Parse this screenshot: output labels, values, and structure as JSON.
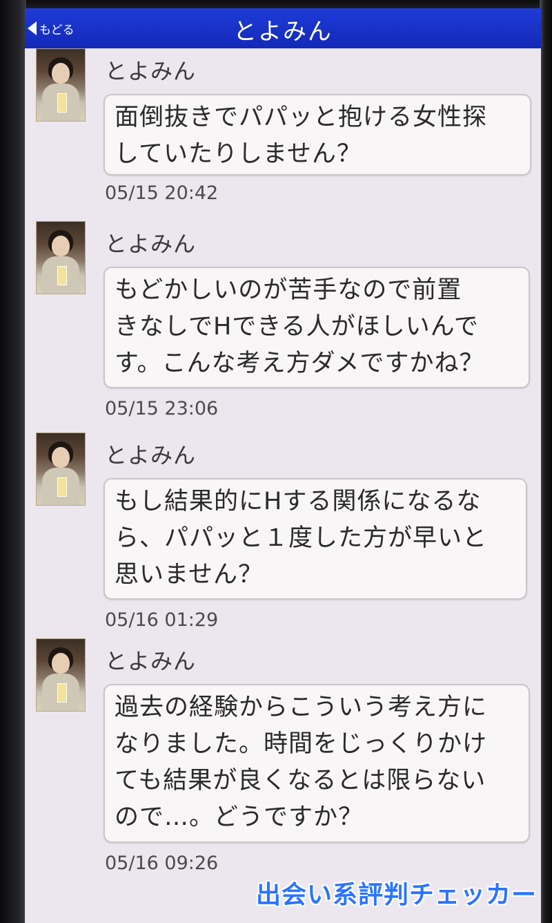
{
  "nav": {
    "back_label": "もどる",
    "title": "とよみん"
  },
  "messages": [
    {
      "sender": "とよみん",
      "text": "面倒抜きでパパッと抱ける女性探\nしていたりしません？",
      "time": "05/15 20:42"
    },
    {
      "sender": "とよみん",
      "text": "もどかしいのが苦手なので前置\nきなしでHできる人がほしいんで\nす。こんな考え方ダメですかね？",
      "time": "05/15 23:06"
    },
    {
      "sender": "とよみん",
      "text": "もし結果的にHする関係になるな\nら、パパッと１度した方が早いと\n思いません？",
      "time": "05/16 01:29"
    },
    {
      "sender": "とよみん",
      "text": "過去の経験からこういう考え方に\nなりました。時間をじっくりかけ\nても結果が良くなるとは限らない\nので…。どうですか？",
      "time": "05/16 09:26"
    }
  ],
  "watermark": "出会い系評判チェッカー",
  "colors": {
    "nav_bar": "#1329b8",
    "screen_bg": "#ece7ee",
    "bubble_bg": "#f8f6f7",
    "watermark": "#2b74ff"
  }
}
